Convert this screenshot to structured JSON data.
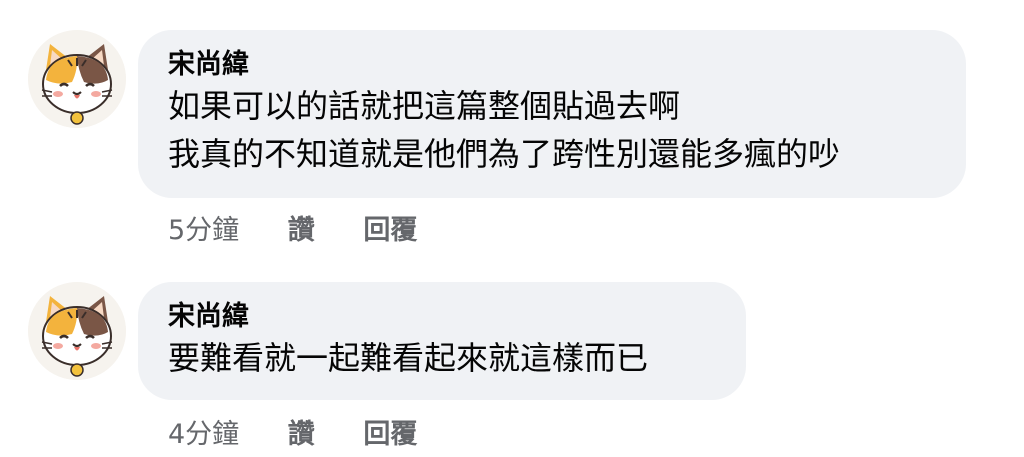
{
  "comments": [
    {
      "author": "宋尚緯",
      "lines": [
        "如果可以的話就把這篇整個貼過去啊",
        "我真的不知道就是他們為了跨性別還能多瘋的吵"
      ],
      "time": "5分鐘",
      "like_label": "讚",
      "reply_label": "回覆",
      "avatar_icon": "tabby-cat-avatar-icon"
    },
    {
      "author": "宋尚緯",
      "lines": [
        "要難看就一起難看起來就這樣而已"
      ],
      "time": "4分鐘",
      "like_label": "讚",
      "reply_label": "回覆",
      "avatar_icon": "tabby-cat-avatar-icon"
    }
  ],
  "colors": {
    "bubble_bg": "#f0f2f5",
    "text": "#050505",
    "meta": "#65676b"
  }
}
